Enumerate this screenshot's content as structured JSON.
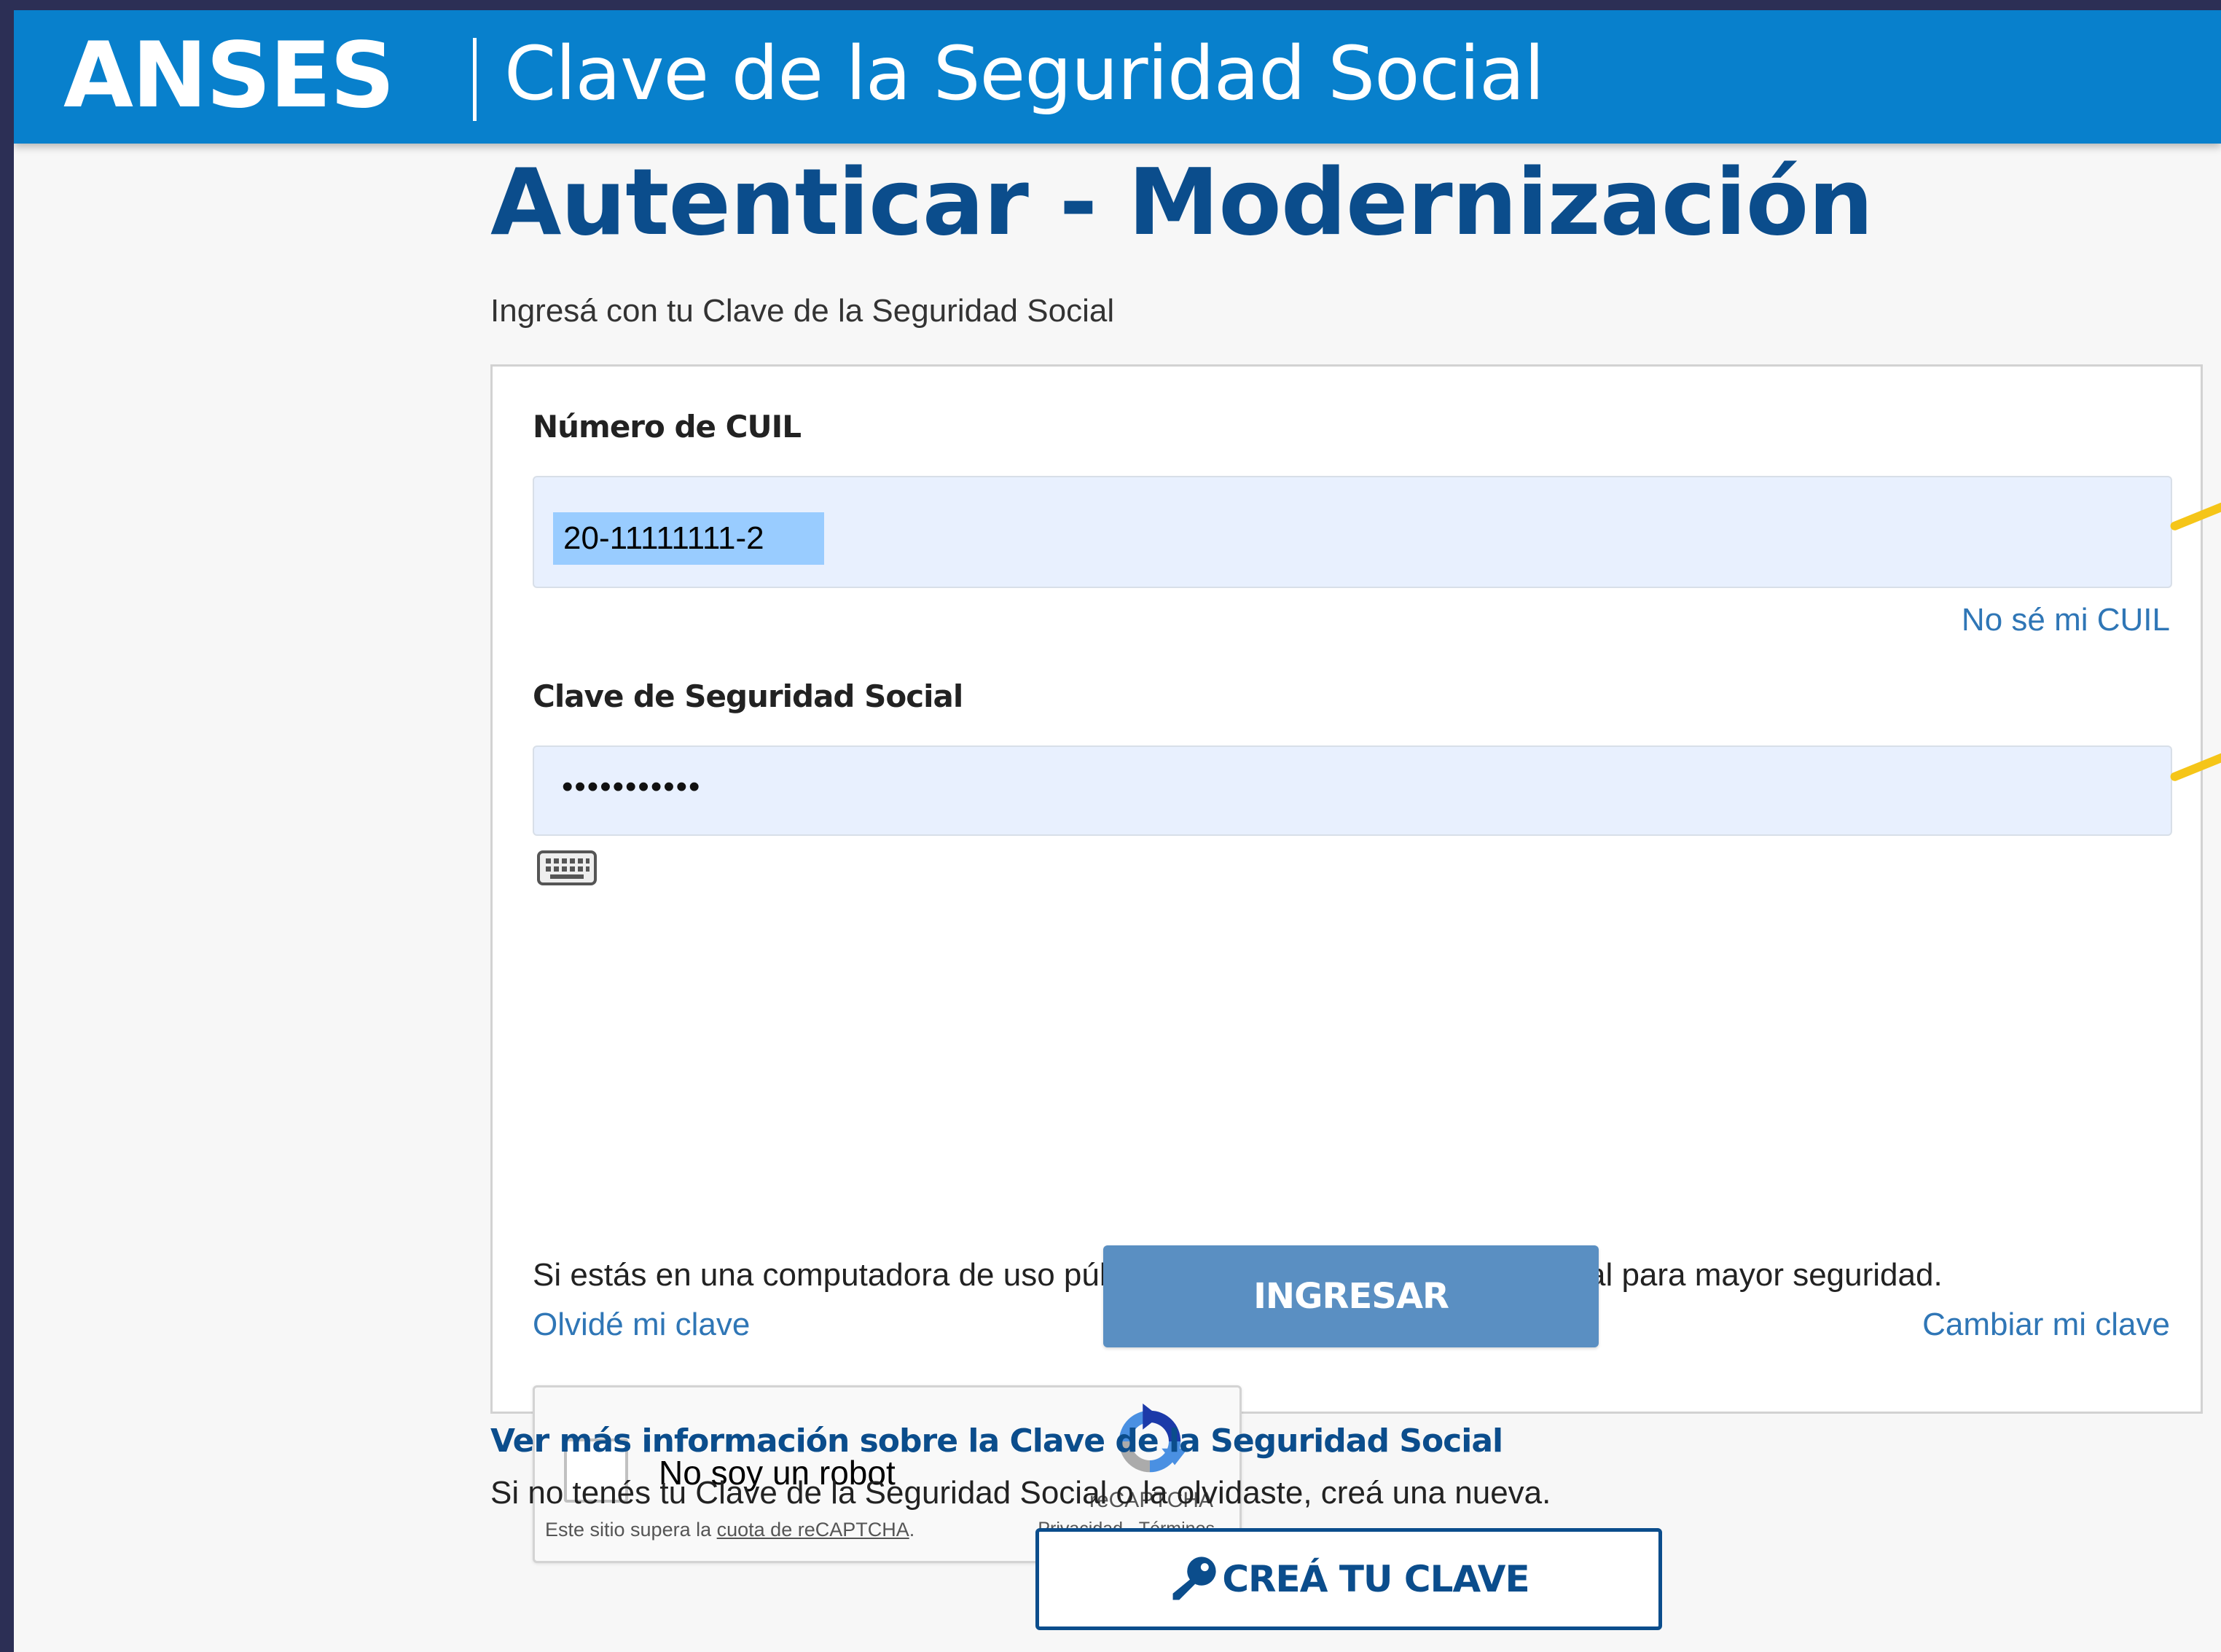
{
  "header": {
    "brand": "ANSES",
    "app_title": "Clave de la Seguridad Social"
  },
  "page": {
    "title": "Autenticar - Modernización",
    "subtitle": "Ingresá con tu Clave de la Seguridad Social"
  },
  "form": {
    "cuil_label": "Número de CUIL",
    "cuil_value": "20-11111111-2",
    "no_cuil_link": "No sé mi CUIL",
    "password_label": "Clave de Seguridad Social",
    "password_value": "•••••••••••",
    "virtual_keyboard_icon": "keyboard-icon",
    "help_text": "Si estás en una computadora de uso público, podés utilizar el teclado virtual para mayor seguridad.",
    "forgot_link": "Olvidé mi clave",
    "change_link": "Cambiar mi clave",
    "submit_label": "INGRESAR"
  },
  "recaptcha": {
    "label": "No soy un robot",
    "note_prefix": "Este sitio supera la ",
    "note_link": "cuota de reCAPTCHA",
    "note_suffix": ".",
    "brand": "reCAPTCHA",
    "links": "Privacidad - Términos",
    "checked": false
  },
  "footer": {
    "more_info_link": "Ver más información sobre la Clave de la Seguridad Social",
    "more_info_text": "Si no tenés tu Clave de la Seguridad Social o la olvidaste, creá una nueva.",
    "create_button_label": "CREÁ TU CLAVE",
    "create_button_icon": "key-icon"
  },
  "colors": {
    "header_bg": "#0880cc",
    "title": "#0b4d8c",
    "link": "#2f76b6",
    "submit_bg": "#5a8fc2",
    "field_bg": "#e8f0fe",
    "annotation": "#f5c518"
  }
}
